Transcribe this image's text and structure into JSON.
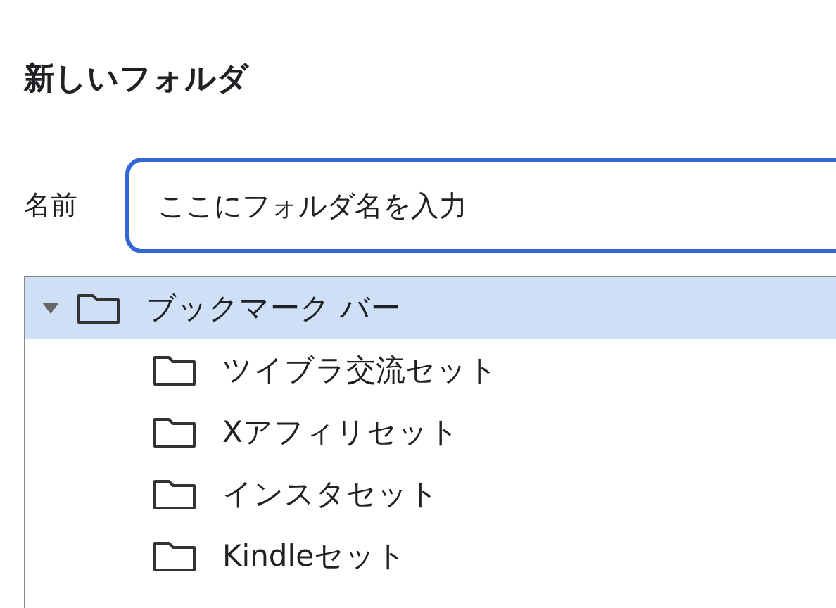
{
  "dialog": {
    "title": "新しいフォルダ"
  },
  "name_field": {
    "label": "名前",
    "value": "ここにフォルダ名を入力"
  },
  "folder_tree": [
    {
      "label": "ブックマーク バー",
      "selected": true,
      "expanded": true,
      "children": [
        {
          "label": "ツイブラ交流セット",
          "selected": false
        },
        {
          "label": "Xアフィリセット",
          "selected": false
        },
        {
          "label": "インスタセット",
          "selected": false
        },
        {
          "label": "Kindleセット",
          "selected": false
        }
      ]
    }
  ]
}
